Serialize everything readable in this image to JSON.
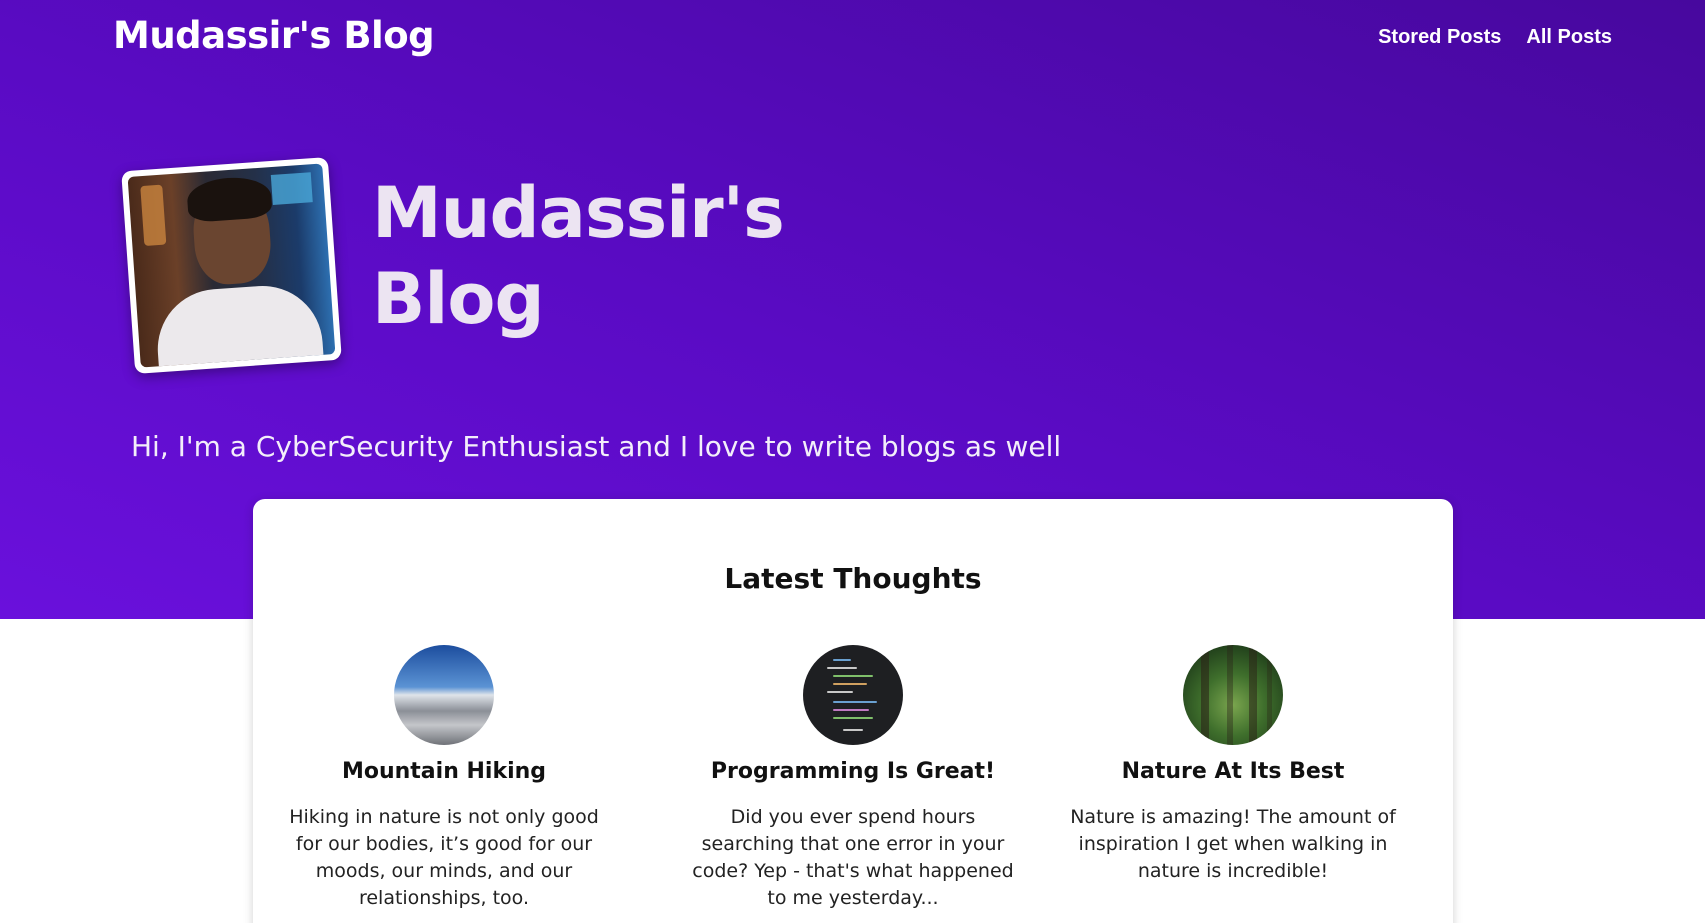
{
  "header": {
    "site_title": "Mudassir's Blog",
    "nav": [
      {
        "label": "Stored Posts"
      },
      {
        "label": "All Posts"
      }
    ]
  },
  "hero": {
    "title_line1": "Mudassir's",
    "title_line2": "Blog",
    "tagline": "Hi, I'm a CyberSecurity Enthusiast and I love to write blogs as well",
    "gradient_colors": [
      "#47089e",
      "#6a10dc"
    ]
  },
  "latest": {
    "heading": "Latest Thoughts",
    "posts": [
      {
        "title": "Mountain Hiking",
        "excerpt": "Hiking in nature is not only good for our bodies, it’s good for our moods, our minds, and our relationships, too.",
        "thumbnail": "mountain-image"
      },
      {
        "title": "Programming Is Great!",
        "excerpt": "Did you ever spend hours searching that one error in your code? Yep - that's what happened to me yesterday...",
        "thumbnail": "code-image"
      },
      {
        "title": "Nature At Its Best",
        "excerpt": "Nature is amazing! The amount of inspiration I get when walking in nature is incredible!",
        "thumbnail": "forest-image"
      }
    ]
  }
}
